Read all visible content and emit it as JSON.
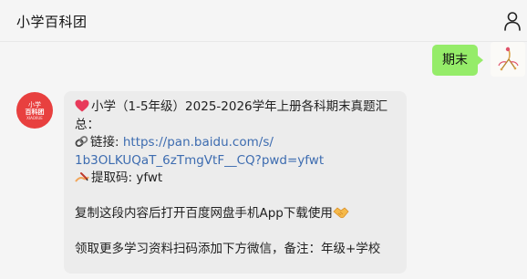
{
  "header": {
    "title": "小学百科团",
    "profile_icon": "person-icon"
  },
  "outgoing_message": {
    "text": "期末"
  },
  "bot_avatar": {
    "line1": "小学",
    "line2": "百科团",
    "line3": "XIAOXUE"
  },
  "incoming_message": {
    "title_line1": "小学（1-5年级）2025-2026学年上册各科期末真题汇",
    "title_line2": "总：",
    "link_label": "链接: ",
    "link_line1": "https://pan.baidu.com/s/",
    "link_line2": "1b3OLKUQaT_6zTmgVtF__CQ?pwd=yfwt",
    "code_label": "提取码: ",
    "code_value": "yfwt",
    "copy_text": "复制这段内容后打开百度网盘手机App下载使用",
    "follow_text": "领取更多学习资料扫码添加下方微信，备注：年级+学校"
  },
  "colors": {
    "outgoing_bubble": "#95ec69",
    "incoming_bubble": "#ececec",
    "link": "#3d6cb0",
    "bot_avatar": "#e8403f"
  }
}
